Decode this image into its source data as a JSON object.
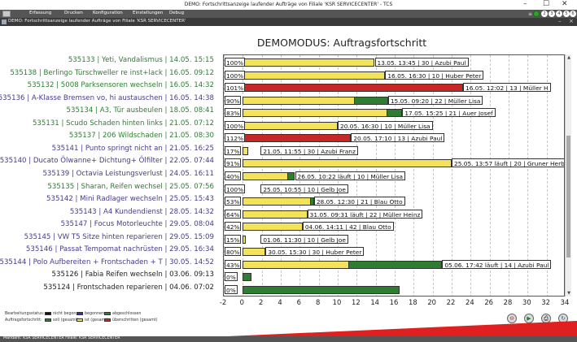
{
  "window": {
    "title": "DEMO: Fortschrittsanzeige laufender Aufträge von Filiale 'KSR SERVICECENTER' - TCS",
    "minimize": "–",
    "maximize": "☐",
    "close": "✕"
  },
  "menu": [
    {
      "label": "Erfassung"
    },
    {
      "label": "Drucken"
    },
    {
      "label": "Konfiguration"
    },
    {
      "label": "Einstellungen"
    },
    {
      "label": "Debug"
    }
  ],
  "menu_right": {
    "search": "≡",
    "numbers": [
      "2",
      "3",
      "4",
      "5",
      "6"
    ]
  },
  "subwindow": {
    "title": "DEMO: Fortschrittsanzeige laufender Aufträge von Filiale 'KSR SERVICECENTER'",
    "min": "–",
    "close": "×"
  },
  "heading": "DEMOMODUS: Auftragsfortschritt",
  "chart_data": {
    "type": "bar",
    "xlim": [
      -2,
      34
    ],
    "xticks": [
      "-2",
      "0",
      "2",
      "4",
      "6",
      "8",
      "10",
      "12",
      "14",
      "16",
      "18",
      "20",
      "22",
      "24",
      "26",
      "28",
      "30",
      "32",
      "34"
    ],
    "grid": true,
    "rows": [
      {
        "label": "535133 | Yeti, Vandalismus | 14.05. 15:15",
        "color": "green",
        "pct": "100%",
        "info": "13.05. 13:45 | 30 | Azubi Paul",
        "soll": 13.9,
        "ist": 13.9,
        "over": 0
      },
      {
        "label": "535138 | Berlingo Türschweller re inst+lack | 16.05. 09:12",
        "color": "green",
        "pct": "100%",
        "info": "16.05. 16:30 | 10 | Huber Peter",
        "soll": 15.0,
        "ist": 15.0,
        "over": 0
      },
      {
        "label": "535132 | 5008 Parksensoren wechseln | 16.05. 14:32",
        "color": "green",
        "pct": "101%",
        "info": "16.05. 12:02 | 13 | Müller H",
        "soll": 23.2,
        "ist": 23.2,
        "over": 23.2
      },
      {
        "label": "535136 | A-Klasse Bremsen vo, hi austauschen | 16.05. 14:38",
        "color": "purple",
        "pct": "90%",
        "info": "15.05. 09:20 | 22 | Müller Lisa",
        "soll": 15.3,
        "ist": 11.8,
        "over": 0
      },
      {
        "label": "535134 | A3, Tür ausbeulen | 18.05. 08:41",
        "color": "green",
        "pct": "83%",
        "info": "17.05. 15:25 | 21 | Auer Josef",
        "soll": 16.8,
        "ist": 15.2,
        "over": 0
      },
      {
        "label": "535131 | Scudo Schaden hinten links | 21.05. 07:12",
        "color": "green",
        "pct": "100%",
        "info": "20.05. 16:30 | 10 | Müller Lisa",
        "soll": 10.0,
        "ist": 10.0,
        "over": 0
      },
      {
        "label": "535137 | 206 Wildschaden | 21.05. 08:30",
        "color": "green",
        "pct": "112%",
        "info": "20.05. 17:10 | 13 | Azubi Paul",
        "soll": 11.4,
        "ist": 11.4,
        "over": 11.4
      },
      {
        "label": "535141 | Punto springt nicht an | 21.05. 16:25",
        "color": "purple",
        "pct": "17%",
        "info": "21.05. 11:55 | 30 | Azubi Franz",
        "soll": 0.6,
        "ist": 0.6,
        "over": 0
      },
      {
        "label": "535140 | Ducato Ölwanne+ Dichtung+ Ölfilter | 22.05. 07:44",
        "color": "purple",
        "pct": "91%",
        "info": "25.05. 13:57 läuft | 20 | Gruner Herbert",
        "soll": 22.0,
        "ist": 22.0,
        "over": 0
      },
      {
        "label": "535139 | Octavia Leistungsverlust | 24.05. 16:11",
        "color": "purple",
        "pct": "40%",
        "info": "26.05. 10:22 läuft | 10 | Müller Lisa",
        "soll": 5.5,
        "ist": 4.8,
        "over": 0
      },
      {
        "label": "535135 | Sharan, Reifen wechsel | 25.05. 07:56",
        "color": "green",
        "pct": "100%",
        "info": "25.05. 10:55 | 10 | Gelb Joe",
        "soll": 0.1,
        "ist": 0.1,
        "over": 0
      },
      {
        "label": "535142 | Mini Radlager wechseln | 25.05. 15:43",
        "color": "purple",
        "pct": "53%",
        "info": "28.05. 12:30 | 21 | Blau Otto",
        "soll": 7.5,
        "ist": 7.2,
        "over": 0
      },
      {
        "label": "535143 | A4 Kundendienst | 28.05. 14:32",
        "color": "purple",
        "pct": "64%",
        "info": "31.05. 09:31 läuft | 22 | Müller Heinz",
        "soll": 6.8,
        "ist": 6.8,
        "over": 0
      },
      {
        "label": "535147 | Focus Motorleuchte | 29.05. 08:04",
        "color": "purple",
        "pct": "42%",
        "info": "04.06. 14:11 | 42 | Blau Otto",
        "soll": 6.3,
        "ist": 6.3,
        "over": 0
      },
      {
        "label": "535145 | VW T5 Sitze hinten reparieren | 29.05. 15:09",
        "color": "purple",
        "pct": "15%",
        "info": "01.06. 11:30 | 10 | Gelb Joe",
        "soll": 0.3,
        "ist": 0.3,
        "over": 0
      },
      {
        "label": "535146 | Passat Tempomat nachrüsten | 29.05. 16:34",
        "color": "purple",
        "pct": "80%",
        "info": "30.05. 15:30 | 30 | Huber Peter",
        "soll": 2.4,
        "ist": 2.4,
        "over": 0
      },
      {
        "label": "535144 | Polo Aufbereiten + Frontschaden + T | 30.05. 14:52",
        "color": "purple",
        "pct": "43%",
        "info": "05.06. 17:42 läuft | 14 | Azubi Paul",
        "soll": 21.0,
        "ist": 11.2,
        "over": 0
      },
      {
        "label": "535126 | Fabia Reifen wechseln | 03.06. 09:13",
        "color": "dark",
        "pct": "0%",
        "info": "",
        "soll": 0.9,
        "ist": 0,
        "over": 0
      },
      {
        "label": "535124 | Frontschaden reparieren | 04.06. 07:02",
        "color": "dark",
        "pct": "0%",
        "info": "",
        "soll": 16.5,
        "ist": 0,
        "over": 0
      }
    ]
  },
  "legend": {
    "status_label": "Bearbeitungsstatus:",
    "status_items": [
      {
        "label": "nicht begonnen",
        "color": "#111111"
      },
      {
        "label": "begonnen",
        "color": "#3b2fa0"
      },
      {
        "label": "abgeschlossen",
        "color": "#2e7d32"
      }
    ],
    "progress_label": "Auftragsfortschritt:",
    "progress_items": [
      {
        "label": "soll (gesamt)",
        "color": "#2e7d32"
      },
      {
        "label": "ist (gesamt)",
        "color": "#f2e35a"
      },
      {
        "label": "überschritten (gesamt)",
        "color": "#c62828"
      }
    ]
  },
  "buttons": {
    "stop": "⊖",
    "play": "▶",
    "print": "⎙",
    "refresh": "↻"
  },
  "statusbar": {
    "text": "Mandant: KSR SERVICECENTER   Filiale: KSR SERVICECENTER"
  },
  "colors": {
    "green": "#2e7d32",
    "purple": "#4a3a8a",
    "dark": "#222222",
    "soll": "#2e7d32",
    "ist": "#f2e35a",
    "over": "#c62828",
    "menubar": "#555555"
  }
}
